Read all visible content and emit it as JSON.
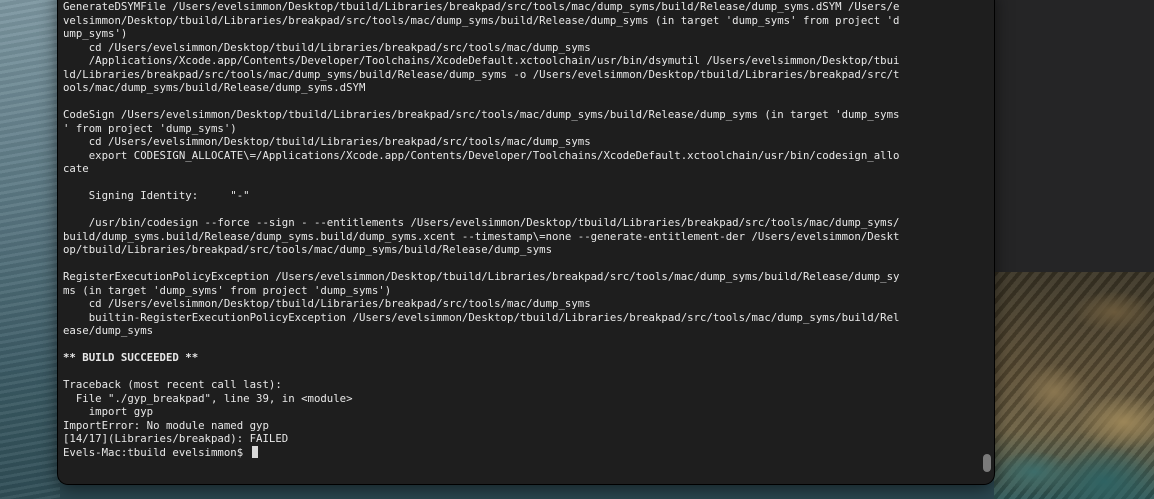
{
  "terminal": {
    "lines": [
      {
        "text": "GenerateDSYMFile /Users/evelsimmon/Desktop/tbuild/Libraries/breakpad/src/tools/mac/dump_syms/build/Release/dump_syms.dSYM /Users/e"
      },
      {
        "text": "velsimmon/Desktop/tbuild/Libraries/breakpad/src/tools/mac/dump_syms/build/Release/dump_syms (in target 'dump_syms' from project 'd"
      },
      {
        "text": "ump_syms')"
      },
      {
        "text": "    cd /Users/evelsimmon/Desktop/tbuild/Libraries/breakpad/src/tools/mac/dump_syms"
      },
      {
        "text": "    /Applications/Xcode.app/Contents/Developer/Toolchains/XcodeDefault.xctoolchain/usr/bin/dsymutil /Users/evelsimmon/Desktop/tbui"
      },
      {
        "text": "ld/Libraries/breakpad/src/tools/mac/dump_syms/build/Release/dump_syms -o /Users/evelsimmon/Desktop/tbuild/Libraries/breakpad/src/t"
      },
      {
        "text": "ools/mac/dump_syms/build/Release/dump_syms.dSYM"
      },
      {
        "text": ""
      },
      {
        "text": "CodeSign /Users/evelsimmon/Desktop/tbuild/Libraries/breakpad/src/tools/mac/dump_syms/build/Release/dump_syms (in target 'dump_syms"
      },
      {
        "text": "' from project 'dump_syms')"
      },
      {
        "text": "    cd /Users/evelsimmon/Desktop/tbuild/Libraries/breakpad/src/tools/mac/dump_syms"
      },
      {
        "text": "    export CODESIGN_ALLOCATE\\=/Applications/Xcode.app/Contents/Developer/Toolchains/XcodeDefault.xctoolchain/usr/bin/codesign_allo"
      },
      {
        "text": "cate"
      },
      {
        "text": ""
      },
      {
        "text": "    Signing Identity:     \"-\""
      },
      {
        "text": ""
      },
      {
        "text": "    /usr/bin/codesign --force --sign - --entitlements /Users/evelsimmon/Desktop/tbuild/Libraries/breakpad/src/tools/mac/dump_syms/"
      },
      {
        "text": "build/dump_syms.build/Release/dump_syms.build/dump_syms.xcent --timestamp\\=none --generate-entitlement-der /Users/evelsimmon/Deskt"
      },
      {
        "text": "op/tbuild/Libraries/breakpad/src/tools/mac/dump_syms/build/Release/dump_syms"
      },
      {
        "text": ""
      },
      {
        "text": "RegisterExecutionPolicyException /Users/evelsimmon/Desktop/tbuild/Libraries/breakpad/src/tools/mac/dump_syms/build/Release/dump_sy"
      },
      {
        "text": "ms (in target 'dump_syms' from project 'dump_syms')"
      },
      {
        "text": "    cd /Users/evelsimmon/Desktop/tbuild/Libraries/breakpad/src/tools/mac/dump_syms"
      },
      {
        "text": "    builtin-RegisterExecutionPolicyException /Users/evelsimmon/Desktop/tbuild/Libraries/breakpad/src/tools/mac/dump_syms/build/Rel"
      },
      {
        "text": "ease/dump_syms"
      },
      {
        "text": ""
      },
      {
        "text": "** BUILD SUCCEEDED **",
        "bold": true
      },
      {
        "text": ""
      },
      {
        "text": "Traceback (most recent call last):"
      },
      {
        "text": "  File \"./gyp_breakpad\", line 39, in <module>"
      },
      {
        "text": "    import gyp"
      },
      {
        "text": "ImportError: No module named gyp"
      },
      {
        "text": "[14/17](Libraries/breakpad): FAILED"
      }
    ],
    "prompt": "Evels-Mac:tbuild evelsimmon$ "
  }
}
